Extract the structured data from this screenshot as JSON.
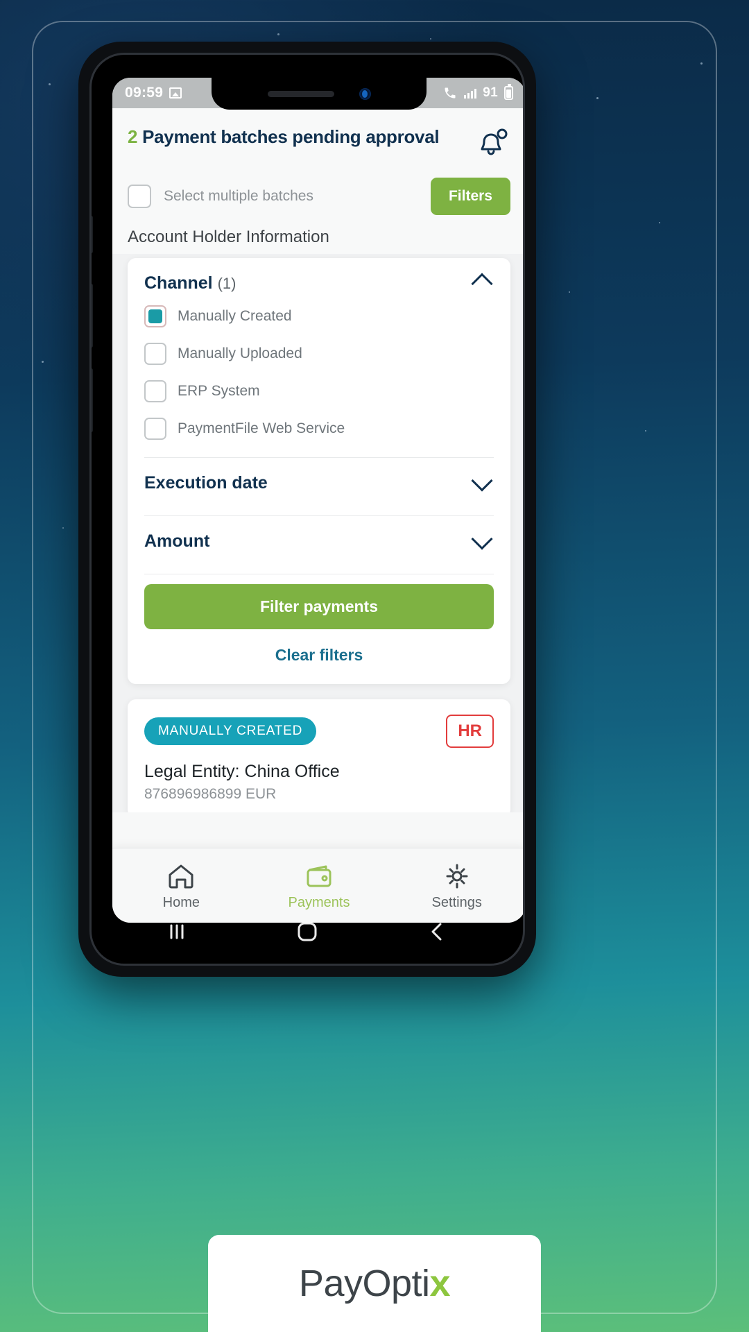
{
  "status_bar": {
    "time": "09:59",
    "left_icon": "image-icon",
    "right_icons": [
      "phone-call-icon",
      "signal-bars-icon"
    ],
    "signal_value": "91",
    "battery_icon": "battery-icon"
  },
  "header": {
    "count": "2",
    "title": "Payment batches pending approval",
    "bell_icon": "notification-bell-icon"
  },
  "select_bar": {
    "checkbox_label": "Select multiple batches",
    "checked": false,
    "filters_button": "Filters"
  },
  "section": {
    "title": "Account Holder Information"
  },
  "filter_panel": {
    "channel": {
      "label": "Channel",
      "count": "(1)",
      "expanded": true,
      "options": [
        {
          "label": "Manually Created",
          "checked": true
        },
        {
          "label": "Manually Uploaded",
          "checked": false
        },
        {
          "label": "ERP System",
          "checked": false
        },
        {
          "label": "PaymentFile Web Service",
          "checked": false
        }
      ]
    },
    "collapsed_sections": [
      {
        "label": "Execution date"
      },
      {
        "label": "Amount"
      }
    ],
    "primary_button": "Filter payments",
    "secondary_link": "Clear filters"
  },
  "batch_card": {
    "tag": "MANUALLY CREATED",
    "badge": "HR",
    "entity": "Legal Entity: China Office",
    "amount": "876896986899 EUR"
  },
  "bottom_nav": [
    {
      "label": "Home",
      "icon": "home-icon",
      "active": false
    },
    {
      "label": "Payments",
      "icon": "wallet-icon",
      "active": true
    },
    {
      "label": "Settings",
      "icon": "gear-icon",
      "active": false
    }
  ],
  "android_nav": {
    "recents": "recents-icon",
    "home": "home-circle-icon",
    "back": "back-chevron-icon"
  },
  "branding": {
    "name_part1": "PayOpti",
    "name_part2": "x"
  },
  "colors": {
    "green": "#7eb242",
    "teal": "#17a2b8",
    "navy": "#11314f",
    "red": "#e23c3c",
    "link": "#1b6f8e"
  }
}
